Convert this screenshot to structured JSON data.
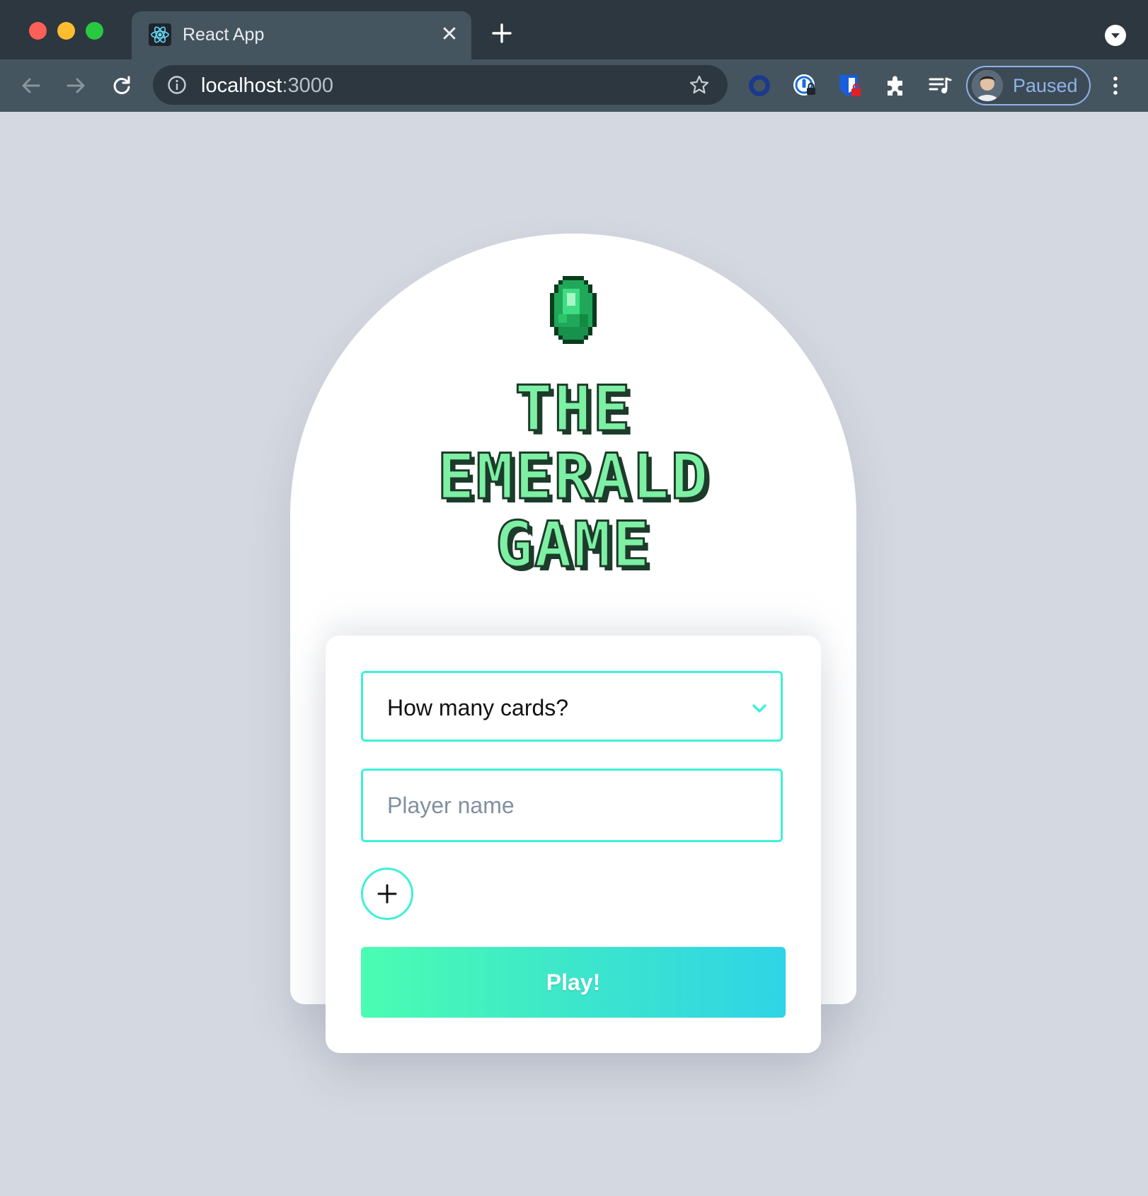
{
  "browser": {
    "tab_title": "React App",
    "url_host": "localhost",
    "url_port": ":3000",
    "profile_label": "Paused",
    "close_glyph": "✕"
  },
  "icons": {
    "favicon": "react-icon",
    "back": "arrow-left-icon",
    "forward": "arrow-right-icon",
    "reload": "reload-icon",
    "info": "info-icon",
    "bookmark": "star-icon",
    "extensions": [
      "circle-extension-icon",
      "lock-extension-icon",
      "bitwarden-icon",
      "puzzle-icon",
      "media-icon"
    ],
    "emerald": "emerald-icon",
    "chevron": "chevron-down-icon",
    "add": "plus-icon"
  },
  "app": {
    "title_lines": [
      "THE",
      "EMERALD",
      "GAME"
    ],
    "select_value": "How many cards?",
    "player_placeholder": "Player name",
    "play_label": "Play!"
  },
  "colors": {
    "accent": "#3ef0d8",
    "gradient_start": "#4afdb2",
    "gradient_end": "#2fd4e6",
    "title_fill": "#7df0a4",
    "title_outline": "#1d3b2a",
    "background": "#d4d8e0"
  }
}
